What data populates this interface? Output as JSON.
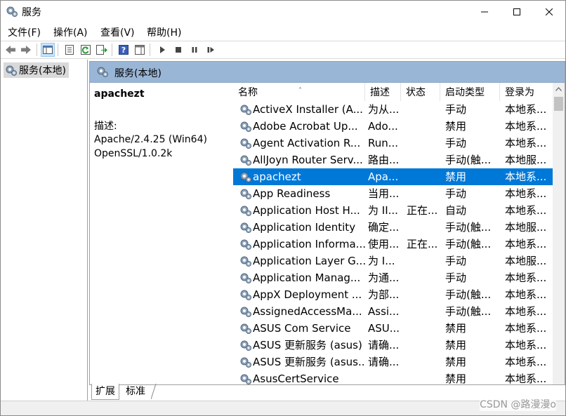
{
  "window": {
    "title": "服务",
    "app_icon": "gears-icon"
  },
  "menubar": {
    "items": [
      "文件(F)",
      "操作(A)",
      "查看(V)",
      "帮助(H)"
    ]
  },
  "toolbar": {
    "icons": [
      "back-arrow-icon",
      "forward-arrow-icon",
      "show-hide-tree-icon",
      "properties-icon",
      "refresh-icon",
      "export-list-icon",
      "help-icon",
      "show-action-pane-icon",
      "start-service-icon",
      "stop-service-icon",
      "pause-service-icon",
      "restart-service-icon"
    ]
  },
  "tree": {
    "items": [
      {
        "label": "服务(本地)",
        "selected": true
      }
    ]
  },
  "content": {
    "header_title": "服务(本地)",
    "selected_service": {
      "name": "apachezt",
      "desc_label": "描述:",
      "desc": "Apache/2.4.25 (Win64)\nOpenSSL/1.0.2k"
    },
    "columns": [
      "名称",
      "描述",
      "状态",
      "启动类型",
      "登录为"
    ],
    "sort_indicator": "˄",
    "rows": [
      {
        "name": "ActiveX Installer (A...",
        "desc": "为从...",
        "status": "",
        "startup": "手动",
        "logon": "本地系..."
      },
      {
        "name": "Adobe Acrobat Up...",
        "desc": "Ado...",
        "status": "",
        "startup": "禁用",
        "logon": "本地系..."
      },
      {
        "name": "Agent Activation R...",
        "desc": "Run...",
        "status": "",
        "startup": "手动",
        "logon": "本地系..."
      },
      {
        "name": "AllJoyn Router Serv...",
        "desc": "路由...",
        "status": "",
        "startup": "手动(触...",
        "logon": "本地服..."
      },
      {
        "name": "apachezt",
        "desc": "Apa...",
        "status": "",
        "startup": "禁用",
        "logon": "本地系...",
        "selected": true
      },
      {
        "name": "App Readiness",
        "desc": "当用...",
        "status": "",
        "startup": "手动",
        "logon": "本地系..."
      },
      {
        "name": "Application Host H...",
        "desc": "为 II...",
        "status": "正在...",
        "startup": "自动",
        "logon": "本地系..."
      },
      {
        "name": "Application Identity",
        "desc": "确定...",
        "status": "",
        "startup": "手动(触...",
        "logon": "本地服..."
      },
      {
        "name": "Application Informa...",
        "desc": "使用...",
        "status": "正在...",
        "startup": "手动(触...",
        "logon": "本地系..."
      },
      {
        "name": "Application Layer G...",
        "desc": "为 I...",
        "status": "",
        "startup": "手动",
        "logon": "本地服..."
      },
      {
        "name": "Application Manag...",
        "desc": "为通...",
        "status": "",
        "startup": "手动",
        "logon": "本地系..."
      },
      {
        "name": "AppX Deployment ...",
        "desc": "为部...",
        "status": "",
        "startup": "手动(触...",
        "logon": "本地系..."
      },
      {
        "name": "AssignedAccessMa...",
        "desc": "Assi...",
        "status": "",
        "startup": "手动(触...",
        "logon": "本地系..."
      },
      {
        "name": "ASUS Com Service",
        "desc": "ASU...",
        "status": "",
        "startup": "禁用",
        "logon": "本地系..."
      },
      {
        "name": "ASUS 更新服务 (asus)",
        "desc": "请确...",
        "status": "",
        "startup": "禁用",
        "logon": "本地系..."
      },
      {
        "name": "ASUS 更新服务 (asus...",
        "desc": "请确...",
        "status": "",
        "startup": "禁用",
        "logon": "本地系..."
      },
      {
        "name": "AsusCertService",
        "desc": "",
        "status": "",
        "startup": "禁用",
        "logon": "本地系..."
      }
    ]
  },
  "tabs": [
    {
      "label": "扩展",
      "active": true
    },
    {
      "label": "标准",
      "active": false
    }
  ],
  "watermark": "CSDN @路漫漫o",
  "colors": {
    "selection": "#0078d7",
    "header_band": "#9ab6d6"
  }
}
